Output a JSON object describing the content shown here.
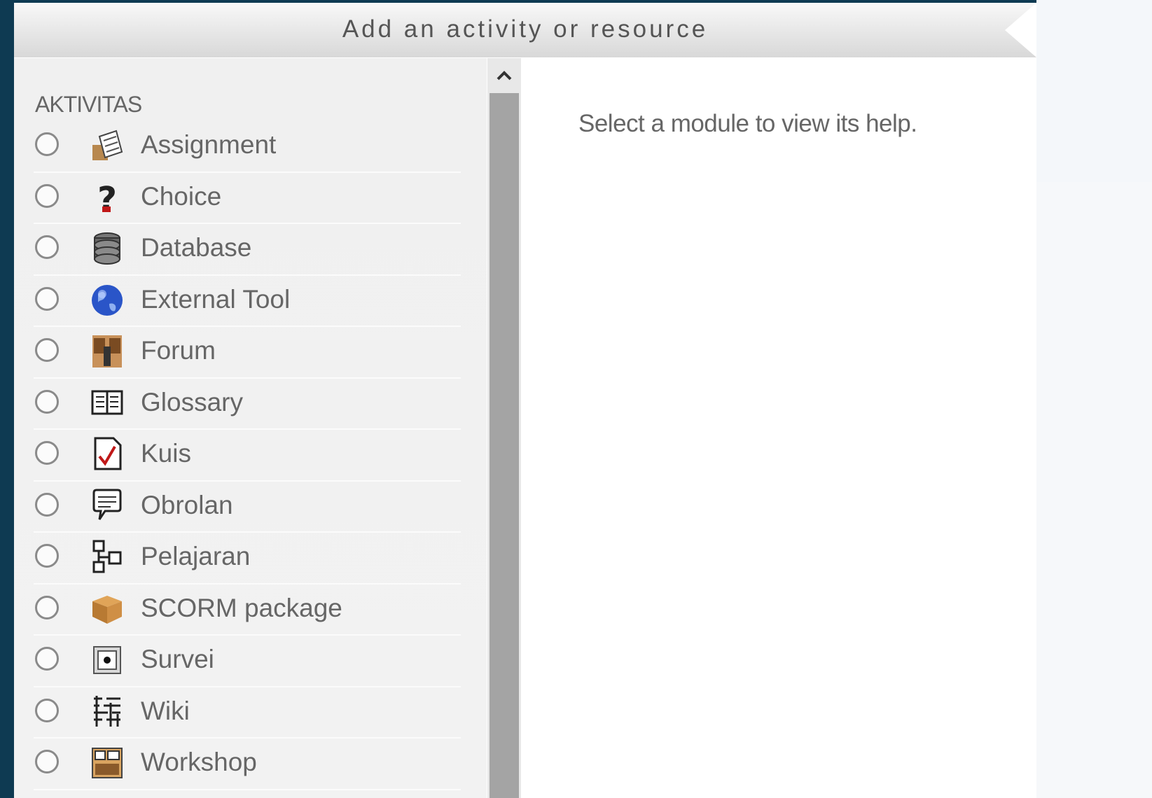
{
  "dialog": {
    "title": "Add an activity or resource"
  },
  "sidebar": {
    "section_title": "AKTIVITAS",
    "items": [
      {
        "label": "Assignment",
        "icon": "assignment-icon"
      },
      {
        "label": "Choice",
        "icon": "question-mark-icon"
      },
      {
        "label": "Database",
        "icon": "database-icon"
      },
      {
        "label": "External Tool",
        "icon": "globe-icon"
      },
      {
        "label": "Forum",
        "icon": "forum-icon"
      },
      {
        "label": "Glossary",
        "icon": "glossary-book-icon"
      },
      {
        "label": "Kuis",
        "icon": "quiz-checkmark-icon"
      },
      {
        "label": "Obrolan",
        "icon": "chat-bubble-icon"
      },
      {
        "label": "Pelajaran",
        "icon": "lesson-flowchart-icon"
      },
      {
        "label": "SCORM package",
        "icon": "scorm-box-icon"
      },
      {
        "label": "Survei",
        "icon": "survey-icon"
      },
      {
        "label": "Wiki",
        "icon": "wiki-icon"
      },
      {
        "label": "Workshop",
        "icon": "workshop-icon"
      }
    ]
  },
  "help": {
    "text": "Select a module to view its help."
  },
  "scrollbar": {
    "up_arrow_icon": "chevron-up-icon"
  }
}
